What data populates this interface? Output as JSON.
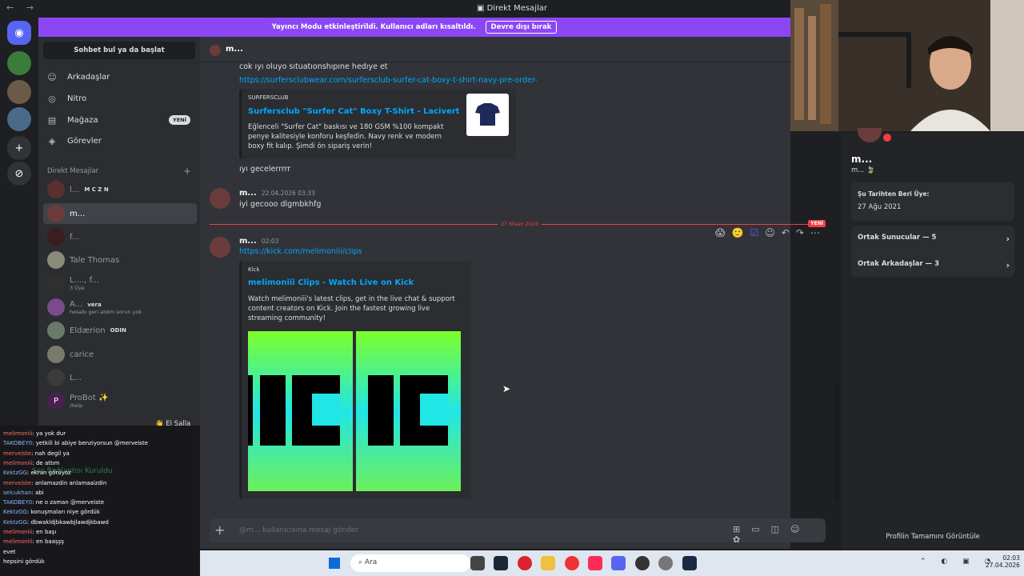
{
  "window": {
    "title": "Direkt Mesajlar"
  },
  "banner": {
    "text": "Yayıncı Modu etkinleştirildi. Kullanıcı adları kısaltıldı.",
    "button": "Devre dışı bırak"
  },
  "sidebar": {
    "search": "Sohbet bul ya da başlat",
    "nav": [
      {
        "label": "Arkadaşlar",
        "icon": "friends-icon"
      },
      {
        "label": "Nitro",
        "icon": "nitro-icon"
      },
      {
        "label": "Mağaza",
        "icon": "shop-icon",
        "badge": "YENİ"
      },
      {
        "label": "Görevler",
        "icon": "quests-icon"
      }
    ],
    "dm_header": "Direkt Mesajlar",
    "dms": [
      {
        "name": "l...",
        "tag": "M C Z N"
      },
      {
        "name": "m..."
      },
      {
        "name": "f..."
      },
      {
        "name": "Tale Thomas"
      },
      {
        "name": "L...., f...",
        "sub": "3 Üye"
      },
      {
        "name": "A...",
        "tag": "vera",
        "sub": "hesabı geri aldım sorun yok"
      },
      {
        "name": "Eldærion",
        "tag": "ODIN"
      },
      {
        "name": "carice"
      },
      {
        "name": "L..."
      },
      {
        "name": "ProBot ✨",
        "sub": "/help"
      }
    ],
    "wave_label": "El Salla",
    "voice_status": "Ses Bağlantısı Kuruldu"
  },
  "chat": {
    "channel": "m...",
    "messages": {
      "m1_text": "cok ıyı oluyo sıtuatıonshıpıne hedıye et",
      "m1_link": "https://surfersclubwear.com/surfersclub-surfer-cat-boxy-t-shirt-navy-pre-order-",
      "embed1": {
        "provider": "SURFERSCLUB",
        "title": "Surfersclub \"Surfer Cat\" Boxy T-Shirt - Lacivert",
        "desc": "Eğlenceli \"Surfer Cat\" baskısı ve 180 GSM %100 kompakt penye kalitesiyle konforu keşfedin. Navy renk ve modern boxy fit kalıp. Şimdi ön sipariş verin!"
      },
      "m2_text": "ıyı gecelerrrrr",
      "m3_author": "m...",
      "m3_time": "22.04.2026 03:33",
      "m3_text": "iyi gecooo dlgmbkhfg",
      "divider_date": "27 Nisan 2026",
      "divider_new": "YENİ",
      "m4_author": "m...",
      "m4_time": "02:03",
      "m4_link": "https://kick.com/melimoniii/clips",
      "embed2": {
        "provider": "Kick",
        "title": "melimoniii Clips - Watch Live on Kick",
        "desc": "Watch melimoniii's latest clips, get in the live chat & support content creators on Kick. Join the fastest growing live streaming community!"
      }
    },
    "composer_placeholder": "@m... kullanıcısına mesaj gönder"
  },
  "profile": {
    "name": "m...",
    "sub": "m...",
    "member_since_label": "Şu Tarihten Beri Üye:",
    "member_since": "27 Ağu 2021",
    "mutual_servers": "Ortak Sunucular — 5",
    "mutual_friends": "Ortak Arkadaşlar — 3",
    "view_full": "Profilin Tamamını Görüntüle"
  },
  "stream_chat": [
    {
      "user": "melimoniii",
      "msg": ": ya yok dur",
      "c": "u1"
    },
    {
      "user": "TAKOBEY0",
      "msg": ": yetkili bi abiye benziyorsun @merveiste",
      "c": "u2"
    },
    {
      "user": "merveiste",
      "msg": ": nah degil ya",
      "c": "u1"
    },
    {
      "user": "melimoniii",
      "msg": ": de attım",
      "c": "u1"
    },
    {
      "user": "KektzGG",
      "msg": ": ekran görüyoz",
      "c": "u2"
    },
    {
      "user": "merveiste",
      "msg": ": anlamazdin anlamaaizdin",
      "c": "u1"
    },
    {
      "user": "selcukhan",
      "msg": ": abi",
      "c": "u2"
    },
    {
      "user": "TAKOBEY0",
      "msg": ": ne o zaman @merveiste",
      "c": "u2"
    },
    {
      "user": "KektzGG",
      "msg": ": konuşmaları niye gördük",
      "c": "u2"
    },
    {
      "user": "KektzGG",
      "msg": ": dbwakldjbkawbjlawdjkbawd",
      "c": "u2"
    },
    {
      "user": "melimoniii",
      "msg": ": en başı",
      "c": "u1"
    },
    {
      "user": "melimoniii",
      "msg": ": en baaşşş",
      "c": "u1"
    },
    {
      "user": "",
      "msg": "evet",
      "c": "u2"
    },
    {
      "user": "",
      "msg": "hepsini gördük",
      "c": "u2"
    }
  ],
  "taskbar": {
    "search": "Ara",
    "time": "02:03",
    "date": "27.04.2026"
  }
}
